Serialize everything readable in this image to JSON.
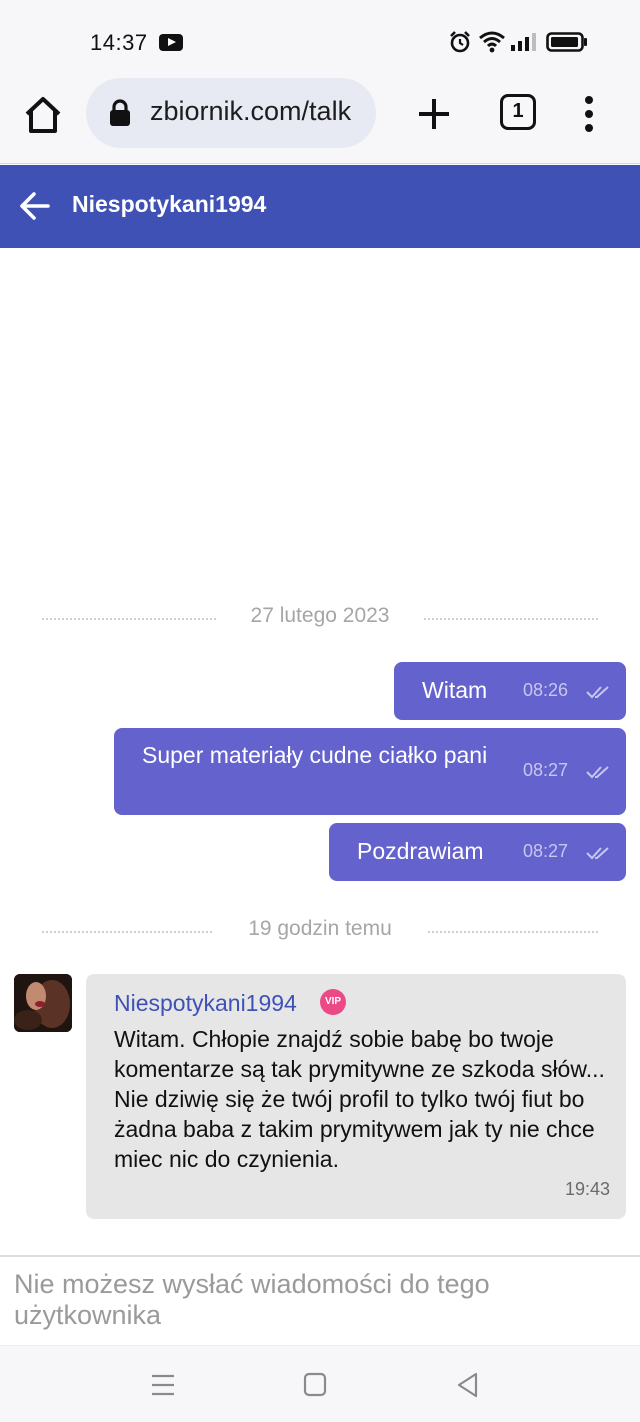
{
  "status_bar": {
    "time": "14:37",
    "icons": [
      "youtube-icon",
      "alarm-icon",
      "wifi-icon",
      "signal-icon",
      "battery-icon"
    ]
  },
  "browser": {
    "url": "zbiornik.com/talk",
    "tab_count": "1"
  },
  "app_header": {
    "title": "Niespotykani1994"
  },
  "chat": {
    "date_separator_1": "27 lutego 2023",
    "date_separator_2": "19 godzin temu",
    "outgoing": [
      {
        "text": "Witam",
        "time": "08:26"
      },
      {
        "text": "Super materiały cudne ciałko pani",
        "time": "08:27"
      },
      {
        "text": "Pozdrawiam",
        "time": "08:27"
      }
    ],
    "incoming": {
      "sender": "Niespotykani1994",
      "badge": "VIP",
      "text": "Witam. Chłopie znajdź sobie babę bo twoje komentarze są tak prymitywne ze szkoda słów... Nie dziwię się że twój profil to tylko twój fiut bo żadna baba z takim prymitywem jak ty nie chce miec nic do czynienia.",
      "time": "19:43"
    }
  },
  "composer": {
    "notice": "Nie możesz wysłać wiadomości do tego użytkownika"
  },
  "colors": {
    "header": "#3f51b5",
    "outgoing_bubble": "#6462cc",
    "incoming_bubble": "#e6e6e6",
    "vip": "#ec4a86"
  }
}
